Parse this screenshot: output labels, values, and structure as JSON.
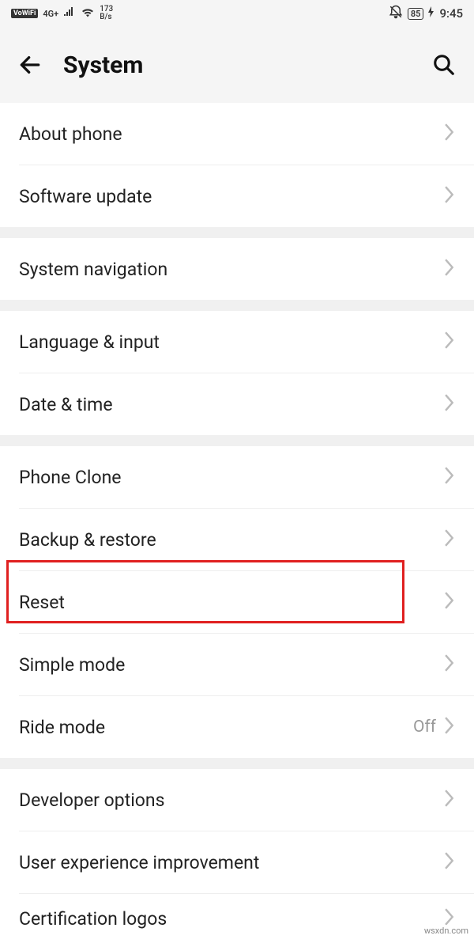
{
  "status": {
    "vowifi": "VoWiFi",
    "network": "4G+",
    "speed_value": "173",
    "speed_unit": "B/s",
    "battery": "85",
    "time": "9:45"
  },
  "header": {
    "title": "System"
  },
  "groups": [
    {
      "items": [
        {
          "id": "about-phone",
          "label": "About phone"
        },
        {
          "id": "software-update",
          "label": "Software update"
        }
      ]
    },
    {
      "items": [
        {
          "id": "system-navigation",
          "label": "System navigation"
        }
      ]
    },
    {
      "items": [
        {
          "id": "language-input",
          "label": "Language & input"
        },
        {
          "id": "date-time",
          "label": "Date & time"
        }
      ]
    },
    {
      "items": [
        {
          "id": "phone-clone",
          "label": "Phone Clone"
        },
        {
          "id": "backup-restore",
          "label": "Backup & restore"
        },
        {
          "id": "reset",
          "label": "Reset",
          "highlighted": true
        },
        {
          "id": "simple-mode",
          "label": "Simple mode"
        },
        {
          "id": "ride-mode",
          "label": "Ride mode",
          "value": "Off"
        }
      ]
    },
    {
      "items": [
        {
          "id": "developer-options",
          "label": "Developer options"
        },
        {
          "id": "user-experience",
          "label": "User experience improvement"
        },
        {
          "id": "certification-logos",
          "label": "Certification logos"
        }
      ]
    }
  ],
  "watermark": "wsxdn.com"
}
